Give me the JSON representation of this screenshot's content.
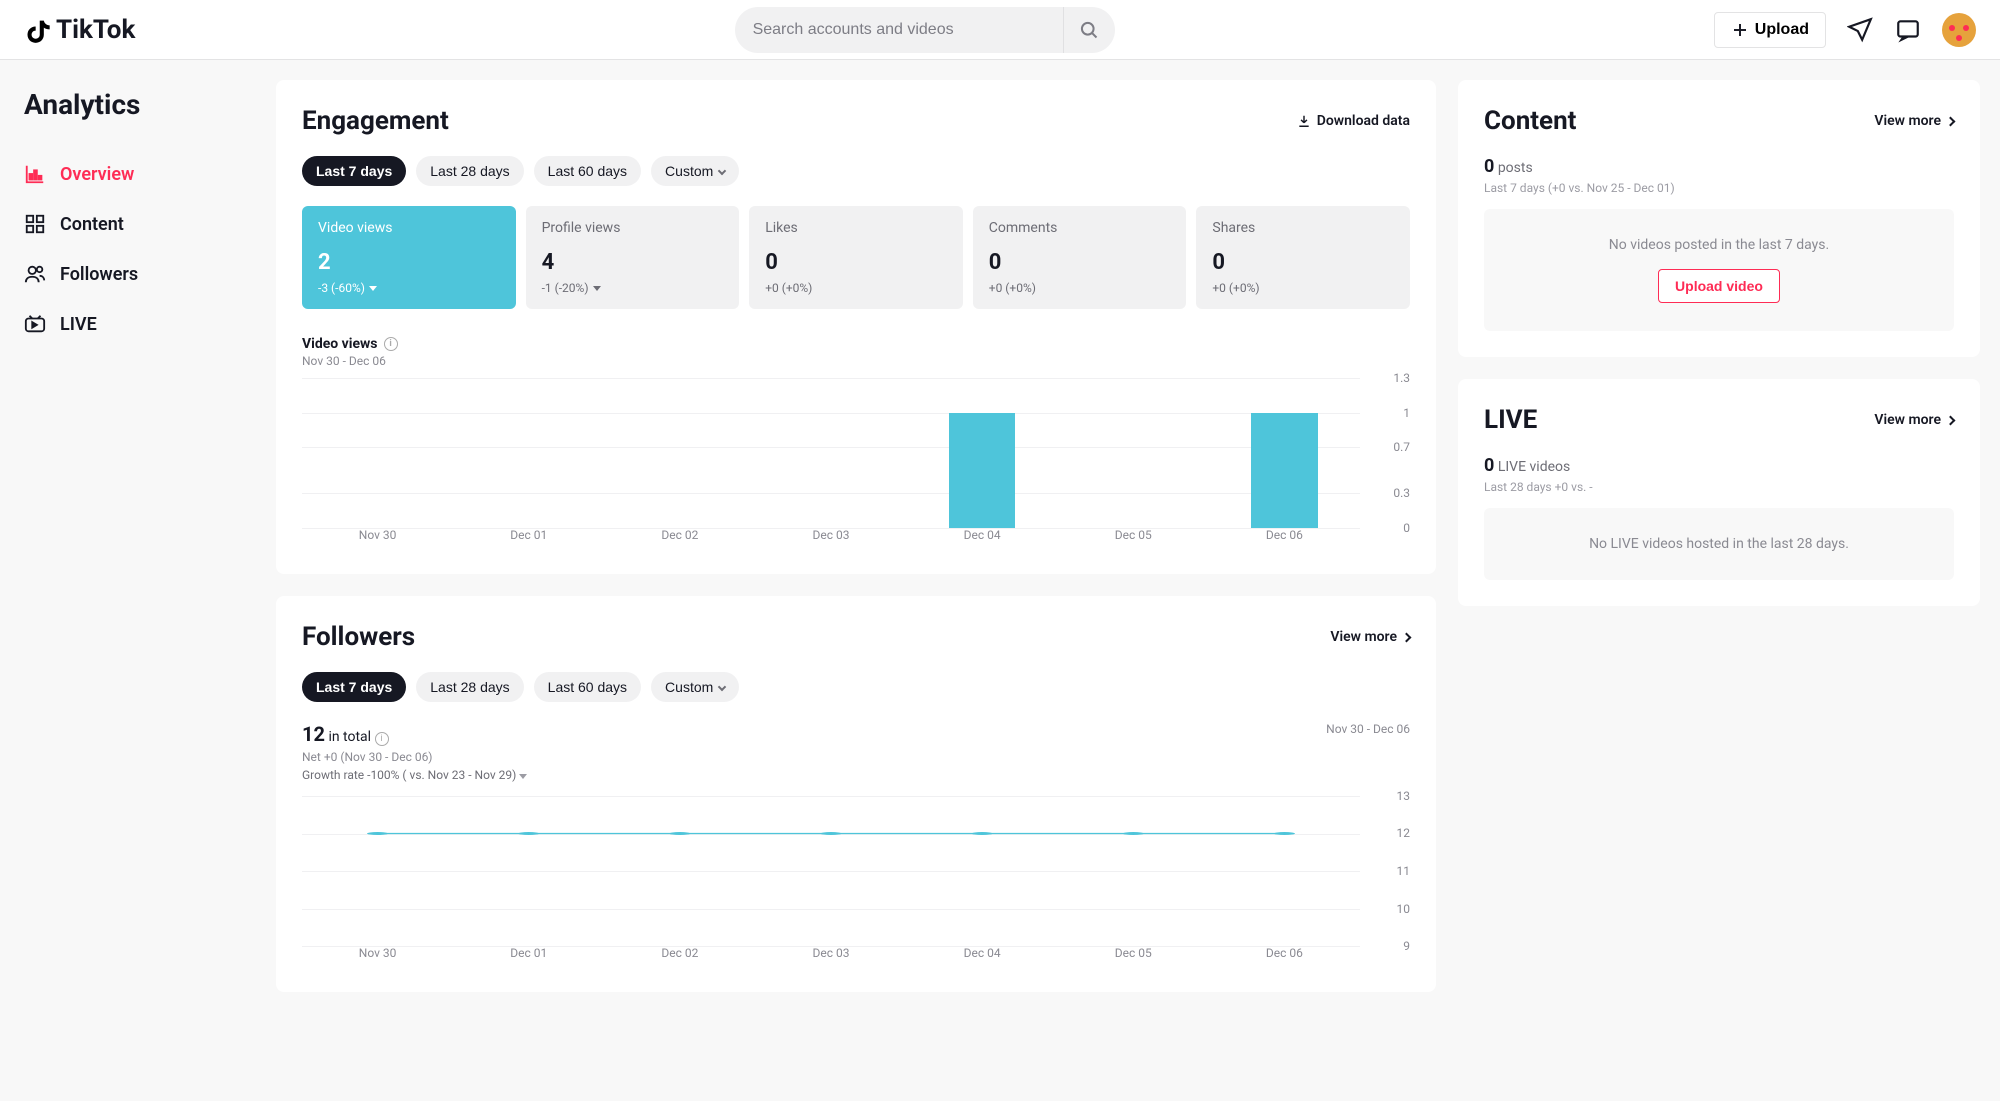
{
  "brand": "TikTok",
  "search": {
    "placeholder": "Search accounts and videos"
  },
  "topbar": {
    "upload": "Upload"
  },
  "sidebar": {
    "title": "Analytics",
    "items": [
      {
        "label": "Overview"
      },
      {
        "label": "Content"
      },
      {
        "label": "Followers"
      },
      {
        "label": "LIVE"
      }
    ]
  },
  "engagement": {
    "title": "Engagement",
    "download": "Download data",
    "chips": [
      "Last 7 days",
      "Last 28 days",
      "Last 60 days",
      "Custom"
    ],
    "kpis": [
      {
        "label": "Video views",
        "value": "2",
        "delta": "-3 (-60%)",
        "trend": "down"
      },
      {
        "label": "Profile views",
        "value": "4",
        "delta": "-1 (-20%)",
        "trend": "down"
      },
      {
        "label": "Likes",
        "value": "0",
        "delta": "+0 (+0%)",
        "trend": "flat"
      },
      {
        "label": "Comments",
        "value": "0",
        "delta": "+0 (+0%)",
        "trend": "flat"
      },
      {
        "label": "Shares",
        "value": "0",
        "delta": "+0 (+0%)",
        "trend": "flat"
      }
    ],
    "chart_title": "Video views",
    "chart_range": "Nov 30 - Dec 06"
  },
  "followers_card": {
    "title": "Followers",
    "viewmore": "View more",
    "chips": [
      "Last 7 days",
      "Last 28 days",
      "Last 60 days",
      "Custom"
    ],
    "total_value": "12",
    "total_label": "in total",
    "net": "Net +0 (Nov 30 - Dec 06)",
    "growth": "Growth rate -100% ( vs. Nov 23 - Nov 29)",
    "range": "Nov 30 - Dec 06"
  },
  "content_card": {
    "title": "Content",
    "viewmore": "View more",
    "count": "0",
    "count_label": "posts",
    "sub": "Last 7 days (+0 vs. Nov 25 - Dec 01)",
    "empty": "No videos posted in the last 7 days.",
    "cta": "Upload video"
  },
  "live_card": {
    "title": "LIVE",
    "viewmore": "View more",
    "count": "0",
    "count_label": "LIVE videos",
    "sub": "Last 28 days +0 vs. -",
    "empty": "No LIVE videos hosted in the last 28 days."
  },
  "chart_data": [
    {
      "type": "bar",
      "title": "Video views",
      "categories": [
        "Nov 30",
        "Dec 01",
        "Dec 02",
        "Dec 03",
        "Dec 04",
        "Dec 05",
        "Dec 06"
      ],
      "values": [
        0,
        0,
        0,
        0,
        1,
        0,
        1
      ],
      "ylim": [
        0,
        1.3
      ],
      "yticks": [
        0,
        0.3,
        0.7,
        1,
        1.3
      ]
    },
    {
      "type": "line",
      "title": "Followers",
      "categories": [
        "Nov 30",
        "Dec 01",
        "Dec 02",
        "Dec 03",
        "Dec 04",
        "Dec 05",
        "Dec 06"
      ],
      "values": [
        12,
        12,
        12,
        12,
        12,
        12,
        12
      ],
      "ylim": [
        9,
        13
      ],
      "yticks": [
        9,
        10,
        11,
        12,
        13
      ]
    }
  ]
}
